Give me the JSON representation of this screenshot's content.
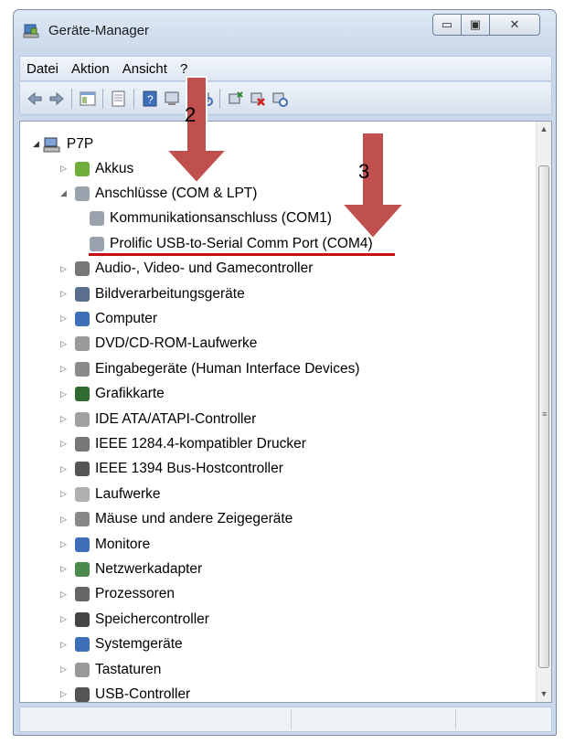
{
  "window": {
    "title": "Geräte-Manager",
    "accent": "#c9d8ea"
  },
  "menu": [
    "Datei",
    "Aktion",
    "Ansicht",
    "?"
  ],
  "toolbar_icons": [
    "back-icon",
    "forward-icon",
    "show-hide-console-tree-icon",
    "properties-icon",
    "help-icon",
    "scan-hardware-icon",
    "update-driver-icon",
    "uninstall-device-icon",
    "disable-device-icon"
  ],
  "tree": {
    "root": "P7P",
    "items": [
      {
        "label": "Akkus",
        "icon": "battery-icon"
      },
      {
        "label": "Anschlüsse (COM & LPT)",
        "icon": "port-icon",
        "expanded": true,
        "children": [
          {
            "label": "Kommunikationsanschluss (COM1)",
            "icon": "port-icon"
          },
          {
            "label": "Prolific USB-to-Serial Comm Port (COM4)",
            "icon": "port-icon",
            "highlighted": true
          }
        ]
      },
      {
        "label": "Audio-, Video- und Gamecontroller",
        "icon": "speaker-icon"
      },
      {
        "label": "Bildverarbeitungsgeräte",
        "icon": "camera-icon"
      },
      {
        "label": "Computer",
        "icon": "computer-icon"
      },
      {
        "label": "DVD/CD-ROM-Laufwerke",
        "icon": "optical-drive-icon"
      },
      {
        "label": "Eingabegeräte (Human Interface Devices)",
        "icon": "hid-icon"
      },
      {
        "label": "Grafikkarte",
        "icon": "display-adapter-icon"
      },
      {
        "label": "IDE ATA/ATAPI-Controller",
        "icon": "ide-controller-icon"
      },
      {
        "label": "IEEE 1284.4-kompatibler Drucker",
        "icon": "printer-icon"
      },
      {
        "label": "IEEE 1394 Bus-Hostcontroller",
        "icon": "firewire-icon"
      },
      {
        "label": "Laufwerke",
        "icon": "disk-drive-icon"
      },
      {
        "label": "Mäuse und andere Zeigegeräte",
        "icon": "mouse-icon"
      },
      {
        "label": "Monitore",
        "icon": "monitor-icon"
      },
      {
        "label": "Netzwerkadapter",
        "icon": "network-adapter-icon"
      },
      {
        "label": "Prozessoren",
        "icon": "processor-icon"
      },
      {
        "label": "Speichercontroller",
        "icon": "storage-controller-icon"
      },
      {
        "label": "Systemgeräte",
        "icon": "system-devices-icon"
      },
      {
        "label": "Tastaturen",
        "icon": "keyboard-icon"
      },
      {
        "label": "USB-Controller",
        "icon": "usb-icon"
      }
    ]
  },
  "annotations": [
    {
      "label": "2",
      "color": "#c0504d"
    },
    {
      "label": "3",
      "color": "#c0504d"
    }
  ],
  "highlight_color": "#c41010"
}
